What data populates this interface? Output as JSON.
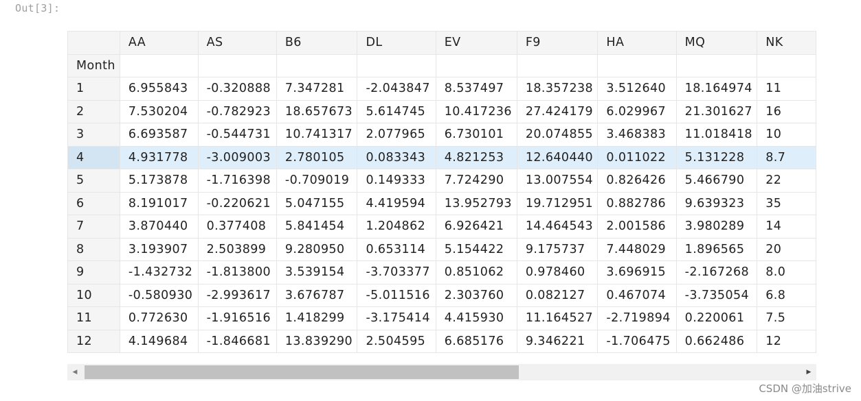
{
  "prompt": "Out[3]:",
  "table": {
    "index_name": "Month",
    "columns": [
      "AA",
      "AS",
      "B6",
      "DL",
      "EV",
      "F9",
      "HA",
      "MQ",
      "NK"
    ],
    "rows": [
      {
        "index": "1",
        "values": [
          "6.955843",
          "-0.320888",
          "7.347281",
          "-2.043847",
          "8.537497",
          "18.357238",
          "3.512640",
          "18.164974",
          "11"
        ]
      },
      {
        "index": "2",
        "values": [
          "7.530204",
          "-0.782923",
          "18.657673",
          "5.614745",
          "10.417236",
          "27.424179",
          "6.029967",
          "21.301627",
          "16"
        ]
      },
      {
        "index": "3",
        "values": [
          "6.693587",
          "-0.544731",
          "10.741317",
          "2.077965",
          "6.730101",
          "20.074855",
          "3.468383",
          "11.018418",
          "10"
        ]
      },
      {
        "index": "4",
        "values": [
          "4.931778",
          "-3.009003",
          "2.780105",
          "0.083343",
          "4.821253",
          "12.640440",
          "0.011022",
          "5.131228",
          "8.7"
        ]
      },
      {
        "index": "5",
        "values": [
          "5.173878",
          "-1.716398",
          "-0.709019",
          "0.149333",
          "7.724290",
          "13.007554",
          "0.826426",
          "5.466790",
          "22"
        ]
      },
      {
        "index": "6",
        "values": [
          "8.191017",
          "-0.220621",
          "5.047155",
          "4.419594",
          "13.952793",
          "19.712951",
          "0.882786",
          "9.639323",
          "35"
        ]
      },
      {
        "index": "7",
        "values": [
          "3.870440",
          "0.377408",
          "5.841454",
          "1.204862",
          "6.926421",
          "14.464543",
          "2.001586",
          "3.980289",
          "14"
        ]
      },
      {
        "index": "8",
        "values": [
          "3.193907",
          "2.503899",
          "9.280950",
          "0.653114",
          "5.154422",
          "9.175737",
          "7.448029",
          "1.896565",
          "20"
        ]
      },
      {
        "index": "9",
        "values": [
          "-1.432732",
          "-1.813800",
          "3.539154",
          "-3.703377",
          "0.851062",
          "0.978460",
          "3.696915",
          "-2.167268",
          "8.0"
        ]
      },
      {
        "index": "10",
        "values": [
          "-0.580930",
          "-2.993617",
          "3.676787",
          "-5.011516",
          "2.303760",
          "0.082127",
          "0.467074",
          "-3.735054",
          "6.8"
        ]
      },
      {
        "index": "11",
        "values": [
          "0.772630",
          "-1.916516",
          "1.418299",
          "-3.175414",
          "4.415930",
          "11.164527",
          "-2.719894",
          "0.220061",
          "7.5"
        ]
      },
      {
        "index": "12",
        "values": [
          "4.149684",
          "-1.846681",
          "13.839290",
          "2.504595",
          "6.685176",
          "9.346221",
          "-1.706475",
          "0.662486",
          "12"
        ]
      }
    ],
    "highlighted_row": 3
  },
  "scrollbar": {
    "left_arrow": "◀",
    "right_arrow": "▶"
  },
  "watermark": "CSDN @加油strive"
}
